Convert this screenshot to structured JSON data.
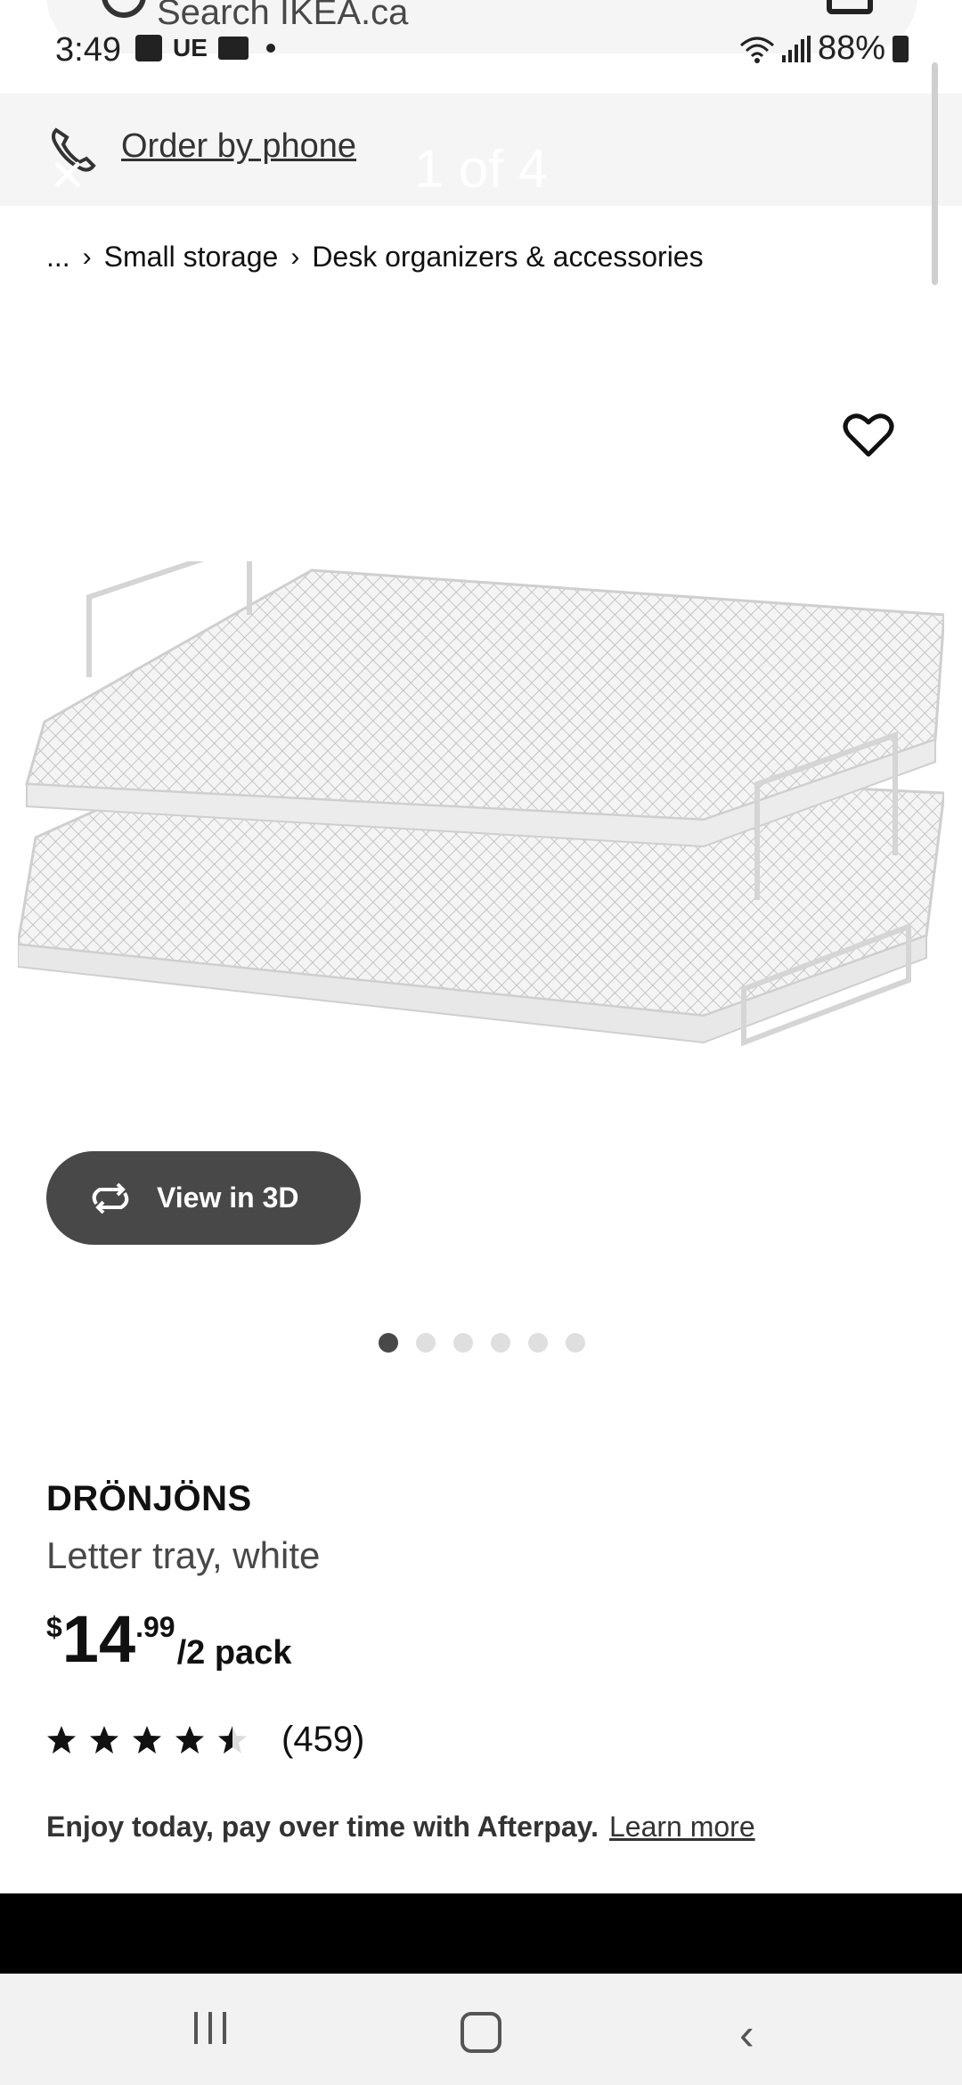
{
  "status_bar": {
    "time": "3:49",
    "ue_label": "UE",
    "battery": "88%"
  },
  "search": {
    "placeholder": "Search IKEA.ca"
  },
  "phone_bar": {
    "link": "Order by phone",
    "carousel_counter": "1 of 4"
  },
  "breadcrumb": {
    "ellipsis": "...",
    "items": [
      "Small storage",
      "Desk organizers & accessories"
    ]
  },
  "product": {
    "name": "DRÖNJÖNS",
    "description": "Letter tray, white",
    "price": {
      "currency": "$",
      "whole": "14",
      "decimals": ".99",
      "unit": "/2 pack"
    },
    "rating": {
      "stars": 4.5,
      "max": 5,
      "count": "(459)"
    },
    "view_3d_label": "View in 3D",
    "image_count": 6,
    "active_image": 1
  },
  "afterpay": {
    "text": "Enjoy today, pay over time with Afterpay.",
    "link": "Learn more"
  },
  "colors": {
    "button_dark": "#484848",
    "bar_bg": "#f5f5f5",
    "dot_inactive": "#dfdfdf"
  }
}
